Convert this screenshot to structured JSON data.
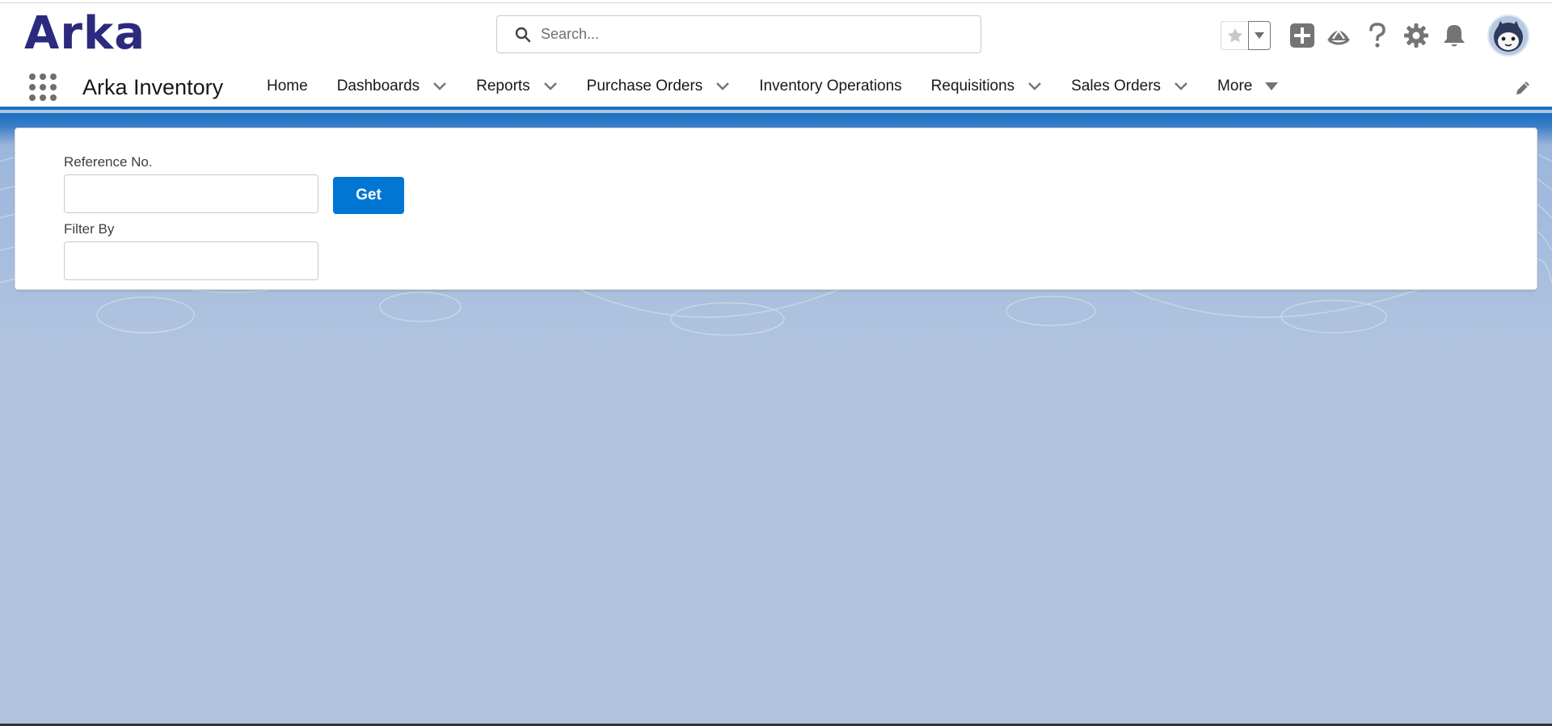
{
  "brand": {
    "logo_text": "Arka"
  },
  "search": {
    "placeholder": "Search..."
  },
  "header_icons": [
    "favorites-star-icon",
    "favorites-dropdown-icon",
    "global-actions-add-icon",
    "trailhead-guidance-icon",
    "help-icon",
    "setup-gear-icon",
    "notifications-bell-icon",
    "user-avatar"
  ],
  "app": {
    "name": "Arka Inventory"
  },
  "nav": {
    "items": [
      {
        "label": "Home",
        "has_menu": false
      },
      {
        "label": "Dashboards",
        "has_menu": true
      },
      {
        "label": "Reports",
        "has_menu": true
      },
      {
        "label": "Purchase Orders",
        "has_menu": true
      },
      {
        "label": "Inventory Operations",
        "has_menu": false
      },
      {
        "label": "Requisitions",
        "has_menu": true
      },
      {
        "label": "Sales Orders",
        "has_menu": true
      },
      {
        "label": "More",
        "has_menu": true
      }
    ]
  },
  "form": {
    "reference_label": "Reference No.",
    "reference_value": "",
    "get_label": "Get",
    "filter_label": "Filter By",
    "filter_value": ""
  },
  "colors": {
    "brand": "#2b2a7e",
    "nav_accent": "#1b6fc2",
    "button": "#0176d3",
    "background": "#b0c4df"
  }
}
